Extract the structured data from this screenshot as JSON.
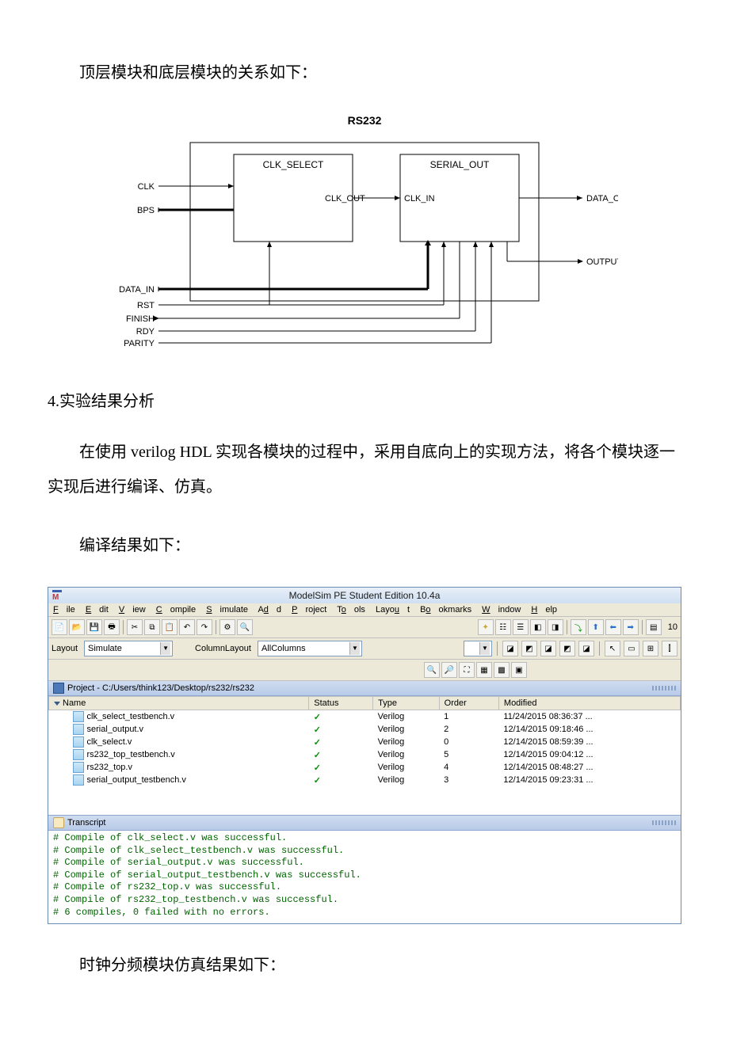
{
  "text": {
    "p1": "顶层模块和底层模块的关系如下：",
    "h4": "4.实验结果分析",
    "p2": "在使用 verilog HDL 实现各模块的过程中，采用自底向上的实现方法，将各个模块逐一实现后进行编译、仿真。",
    "p3": "编译结果如下：",
    "p4": "时钟分频模块仿真结果如下："
  },
  "diagram": {
    "title": "RS232",
    "box1": "CLK_SELECT",
    "box2": "SERIAL_OUT",
    "port_clk_out": "CLK_OUT",
    "port_clk_in": "CLK_IN",
    "left": [
      "CLK",
      "BPS",
      "DATA_IN",
      "RST",
      "FINISH",
      "RDY",
      "PARITY"
    ],
    "right": [
      "DATA_OUT",
      "OUTPUT_EN"
    ]
  },
  "modelsim": {
    "title": "ModelSim PE Student Edition 10.4a",
    "menu": [
      "File",
      "Edit",
      "View",
      "Compile",
      "Simulate",
      "Add",
      "Project",
      "Tools",
      "Layout",
      "Bookmarks",
      "Window",
      "Help"
    ],
    "layout_label": "Layout",
    "layout_value": "Simulate",
    "col_label": "ColumnLayout",
    "col_value": "AllColumns",
    "project_path": "Project - C:/Users/think123/Desktop/rs232/rs232",
    "columns": [
      "Name",
      "Status",
      "Type",
      "Order",
      "Modified"
    ],
    "files": [
      {
        "name": "clk_select_testbench.v",
        "status": "✓",
        "type": "Verilog",
        "order": "1",
        "mod": "11/24/2015 08:36:37 ..."
      },
      {
        "name": "serial_output.v",
        "status": "✓",
        "type": "Verilog",
        "order": "2",
        "mod": "12/14/2015 09:18:46 ..."
      },
      {
        "name": "clk_select.v",
        "status": "✓",
        "type": "Verilog",
        "order": "0",
        "mod": "12/14/2015 08:59:39 ..."
      },
      {
        "name": "rs232_top_testbench.v",
        "status": "✓",
        "type": "Verilog",
        "order": "5",
        "mod": "12/14/2015 09:04:12 ..."
      },
      {
        "name": "rs232_top.v",
        "status": "✓",
        "type": "Verilog",
        "order": "4",
        "mod": "12/14/2015 08:48:27 ..."
      },
      {
        "name": "serial_output_testbench.v",
        "status": "✓",
        "type": "Verilog",
        "order": "3",
        "mod": "12/14/2015 09:23:31 ..."
      }
    ],
    "transcript_label": "Transcript",
    "transcript": [
      "# Compile of clk_select.v was successful.",
      "# Compile of clk_select_testbench.v was successful.",
      "# Compile of serial_output.v was successful.",
      "# Compile of serial_output_testbench.v was successful.",
      "# Compile of rs232_top.v was successful.",
      "# Compile of rs232_top_testbench.v was successful.",
      "# 6 compiles, 0 failed with no errors."
    ],
    "time_end": "10"
  }
}
